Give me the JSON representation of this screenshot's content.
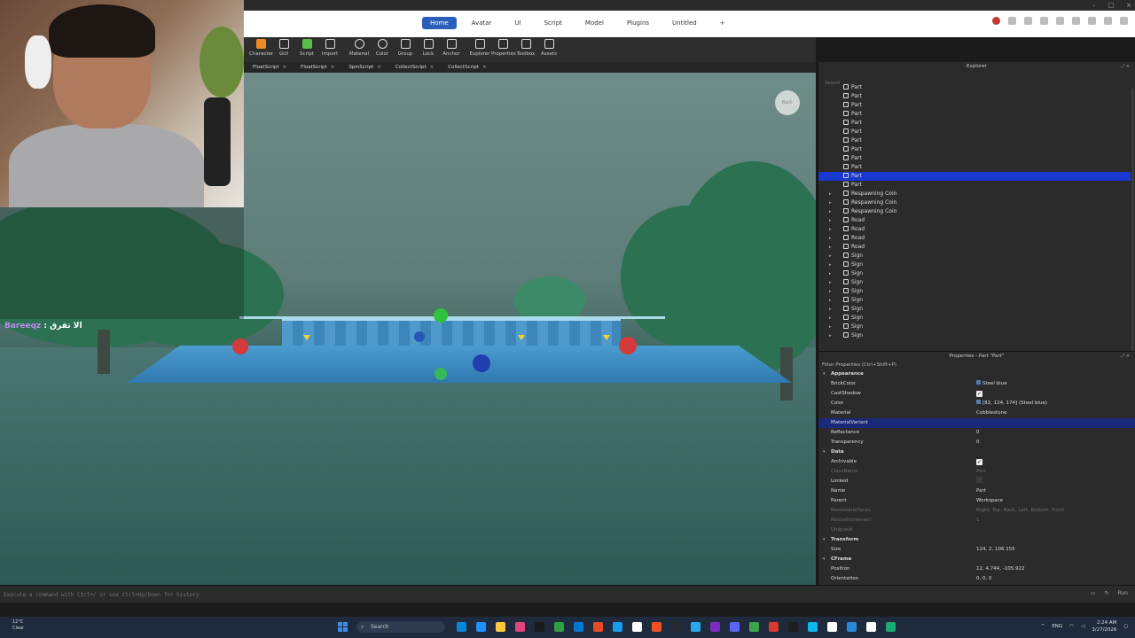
{
  "window": {
    "controls": [
      "–",
      "□",
      "×"
    ]
  },
  "menu": {
    "tabs": [
      "Home",
      "Avatar",
      "UI",
      "Script",
      "Model",
      "Plugins",
      "Untitled"
    ],
    "active_tab": "Home",
    "add_tab": "+"
  },
  "toolbar": {
    "items": [
      "Character",
      "GUI",
      "Script",
      "Import",
      "Material",
      "Color",
      "Group",
      "Lock",
      "Anchor",
      "Explorer",
      "Properties",
      "Toolbox",
      "Assets"
    ]
  },
  "doc_tabs": [
    "FloatScript",
    "FloatScript",
    "SpinScript",
    "CollectScript",
    "CollectScript"
  ],
  "viewport": {
    "back_button": "Back"
  },
  "chat": {
    "user": "Bareeqz",
    "message": ": الا تفرق"
  },
  "explorer": {
    "title": "Explorer",
    "search_placeholder": "Search",
    "items": [
      {
        "label": "Part",
        "expandable": false
      },
      {
        "label": "Part",
        "expandable": false
      },
      {
        "label": "Part",
        "expandable": false
      },
      {
        "label": "Part",
        "expandable": false
      },
      {
        "label": "Part",
        "expandable": false
      },
      {
        "label": "Part",
        "expandable": false
      },
      {
        "label": "Part",
        "expandable": false
      },
      {
        "label": "Part",
        "expandable": false
      },
      {
        "label": "Part",
        "expandable": false
      },
      {
        "label": "Part",
        "expandable": false
      },
      {
        "label": "Part",
        "expandable": false,
        "selected": true
      },
      {
        "label": "Part",
        "expandable": false
      },
      {
        "label": "Respawning Coin",
        "expandable": true
      },
      {
        "label": "Respawning Coin",
        "expandable": true
      },
      {
        "label": "Respawning Coin",
        "expandable": true
      },
      {
        "label": "Road",
        "expandable": true
      },
      {
        "label": "Road",
        "expandable": true
      },
      {
        "label": "Road",
        "expandable": true
      },
      {
        "label": "Road",
        "expandable": true
      },
      {
        "label": "Sign",
        "expandable": true
      },
      {
        "label": "Sign",
        "expandable": true
      },
      {
        "label": "Sign",
        "expandable": true
      },
      {
        "label": "Sign",
        "expandable": true
      },
      {
        "label": "Sign",
        "expandable": true
      },
      {
        "label": "Sign",
        "expandable": true
      },
      {
        "label": "Sign",
        "expandable": true
      },
      {
        "label": "Sign",
        "expandable": true
      },
      {
        "label": "Sign",
        "expandable": true
      },
      {
        "label": "Sign",
        "expandable": true
      }
    ]
  },
  "properties": {
    "title": "Properties - Part \"Part\"",
    "filter_placeholder": "Filter Properties (Ctrl+Shift+P)",
    "rows": [
      {
        "type": "section",
        "key": "Appearance"
      },
      {
        "key": "BrickColor",
        "value": "Steel blue",
        "swatch": "#527cae"
      },
      {
        "key": "CastShadow",
        "check": true
      },
      {
        "key": "Color",
        "value": "[82, 124, 174] (Steel blue)",
        "swatch": "#527cae"
      },
      {
        "key": "Material",
        "value": "Cobblestone"
      },
      {
        "key": "MaterialVariant",
        "value": "",
        "highlight": true
      },
      {
        "key": "Reflectance",
        "value": "0"
      },
      {
        "key": "Transparency",
        "value": "0"
      },
      {
        "type": "section",
        "key": "Data"
      },
      {
        "key": "Archivable",
        "check": true
      },
      {
        "key": "ClassName",
        "value": "Part",
        "dim": true
      },
      {
        "key": "Locked",
        "check": false
      },
      {
        "key": "Name",
        "value": "Part"
      },
      {
        "key": "Parent",
        "value": "Workspace"
      },
      {
        "key": "ResizeableFaces",
        "value": "Right, Top, Back, Left, Bottom, Front",
        "dim": true
      },
      {
        "key": "ResizeIncrement",
        "value": "1",
        "dim": true
      },
      {
        "key": "UniqueId",
        "value": "",
        "dim": true
      },
      {
        "type": "section",
        "key": "Transform"
      },
      {
        "key": "Size",
        "value": "124, 2, 106.155"
      },
      {
        "type": "section",
        "key": "CFrame"
      },
      {
        "key": "Position",
        "value": "12, 4.744, -105.922"
      },
      {
        "key": "Orientation",
        "value": "0, 0, 0"
      }
    ]
  },
  "command_bar": {
    "placeholder": "Execute a command with Ctrl+/ or use Ctrl+Up/Down for history",
    "run_label": "Run"
  },
  "taskbar": {
    "weather_temp": "12°C",
    "weather_desc": "Clear",
    "search_label": "Search",
    "lang": "ENG",
    "time": "2:24 AM",
    "date": "3/27/2026",
    "app_colors": [
      "#0a84d6",
      "#1e90ff",
      "#ffc83d",
      "#e0457b",
      "#1a1a1a",
      "#2ea043",
      "#0078d4",
      "#e44d26",
      "#1b9bf0",
      "#ffffff",
      "#f25022",
      "#24292e",
      "#29a9eb",
      "#7b2cbf",
      "#5865f2",
      "#3fa34d",
      "#d63a2f",
      "#1e1e1e",
      "#0db7ed",
      "#ffffff",
      "#2b88d8",
      "#ffffff",
      "#19a974"
    ]
  }
}
